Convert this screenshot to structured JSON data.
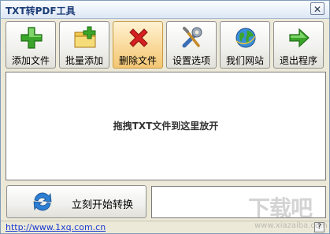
{
  "window": {
    "title": "TXT转PDF工具",
    "close_glyph": "✕"
  },
  "toolbar": {
    "buttons": [
      {
        "label": "添加文件",
        "icon": "plus-icon"
      },
      {
        "label": "批量添加",
        "icon": "folder-add-icon"
      },
      {
        "label": "删除文件",
        "icon": "delete-x-icon",
        "active": true
      },
      {
        "label": "设置选项",
        "icon": "tools-icon"
      },
      {
        "label": "我们网站",
        "icon": "globe-icon"
      },
      {
        "label": "退出程序",
        "icon": "exit-arrow-icon"
      }
    ]
  },
  "dropzone": {
    "hint": "拖拽TXT文件到这里放开"
  },
  "convert": {
    "label": "立刻开始转换",
    "icon": "convert-arrows-icon"
  },
  "status": {
    "link": "http://www.1xq.com.cn",
    "help_glyph": "?"
  },
  "watermark": {
    "text": "下载吧",
    "sub": "www.xiazaiba.com"
  },
  "colors": {
    "accent_green": "#3aa52a",
    "delete_red": "#d42020",
    "active_button": "#f9d99a"
  }
}
